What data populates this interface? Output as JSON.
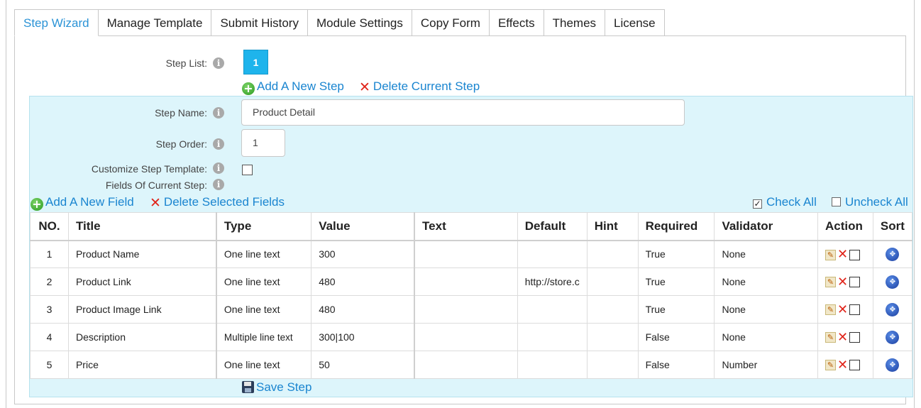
{
  "tabs": [
    {
      "label": "Step Wizard",
      "active": true
    },
    {
      "label": "Manage Template"
    },
    {
      "label": "Submit History"
    },
    {
      "label": "Module Settings"
    },
    {
      "label": "Copy Form"
    },
    {
      "label": "Effects"
    },
    {
      "label": "Themes"
    },
    {
      "label": "License"
    }
  ],
  "step_list": {
    "label": "Step List:",
    "steps": [
      "1"
    ],
    "add_label": "Add A New Step",
    "delete_label": "Delete Current Step"
  },
  "step_form": {
    "name_label": "Step Name:",
    "name_value": "Product Detail",
    "order_label": "Step Order:",
    "order_value": "1",
    "customize_label": "Customize Step Template:",
    "fields_label": "Fields Of Current Step:"
  },
  "field_actions": {
    "add_label": "Add A New Field",
    "delete_label": "Delete Selected Fields",
    "check_all": "Check All",
    "uncheck_all": "Uncheck All"
  },
  "table": {
    "headers": [
      "NO.",
      "Title",
      "Type",
      "Value",
      "Text",
      "Default",
      "Hint",
      "Required",
      "Validator",
      "Action",
      "Sort"
    ],
    "rows": [
      {
        "no": "1",
        "title": "Product Name",
        "type": "One line text",
        "value": "300",
        "text": "",
        "default": "",
        "hint": "",
        "required": "True",
        "validator": "None"
      },
      {
        "no": "2",
        "title": "Product Link",
        "type": "One line text",
        "value": "480",
        "text": "",
        "default": "http://store.c",
        "hint": "",
        "required": "True",
        "validator": "None"
      },
      {
        "no": "3",
        "title": "Product Image Link",
        "type": "One line text",
        "value": "480",
        "text": "",
        "default": "",
        "hint": "",
        "required": "True",
        "validator": "None"
      },
      {
        "no": "4",
        "title": "Description",
        "type": "Multiple line text",
        "value": "300|100",
        "text": "",
        "default": "",
        "hint": "",
        "required": "False",
        "validator": "None"
      },
      {
        "no": "5",
        "title": "Price",
        "type": "One line text",
        "value": "50",
        "text": "",
        "default": "",
        "hint": "",
        "required": "False",
        "validator": "Number"
      }
    ]
  },
  "save_label": "Save Step",
  "icons": {
    "info": "info-icon",
    "add": "green-plus-icon",
    "delete": "red-x-icon",
    "edit": "pencil-icon",
    "sort": "blue-arrows-icon",
    "save": "floppy-disk-icon"
  },
  "colors": {
    "accent": "#1a85d0",
    "step_active": "#1eb4ec",
    "panel_bg": "#ddf5fb",
    "delete_red": "#e0241a"
  }
}
